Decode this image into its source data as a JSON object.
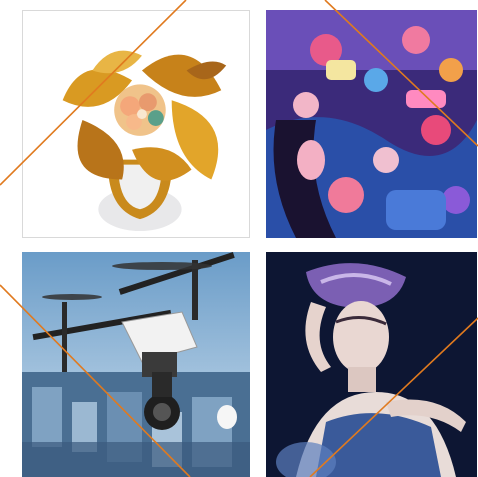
{
  "tiles": [
    {
      "subject": "gold-floral-ring"
    },
    {
      "subject": "illustrated-crowd"
    },
    {
      "subject": "drone-over-city"
    },
    {
      "subject": "fashion-portrait"
    }
  ],
  "colors": {
    "diagonal_line": "#e07a1f",
    "tile_border": "#d9d9d9",
    "background": "#ffffff"
  }
}
